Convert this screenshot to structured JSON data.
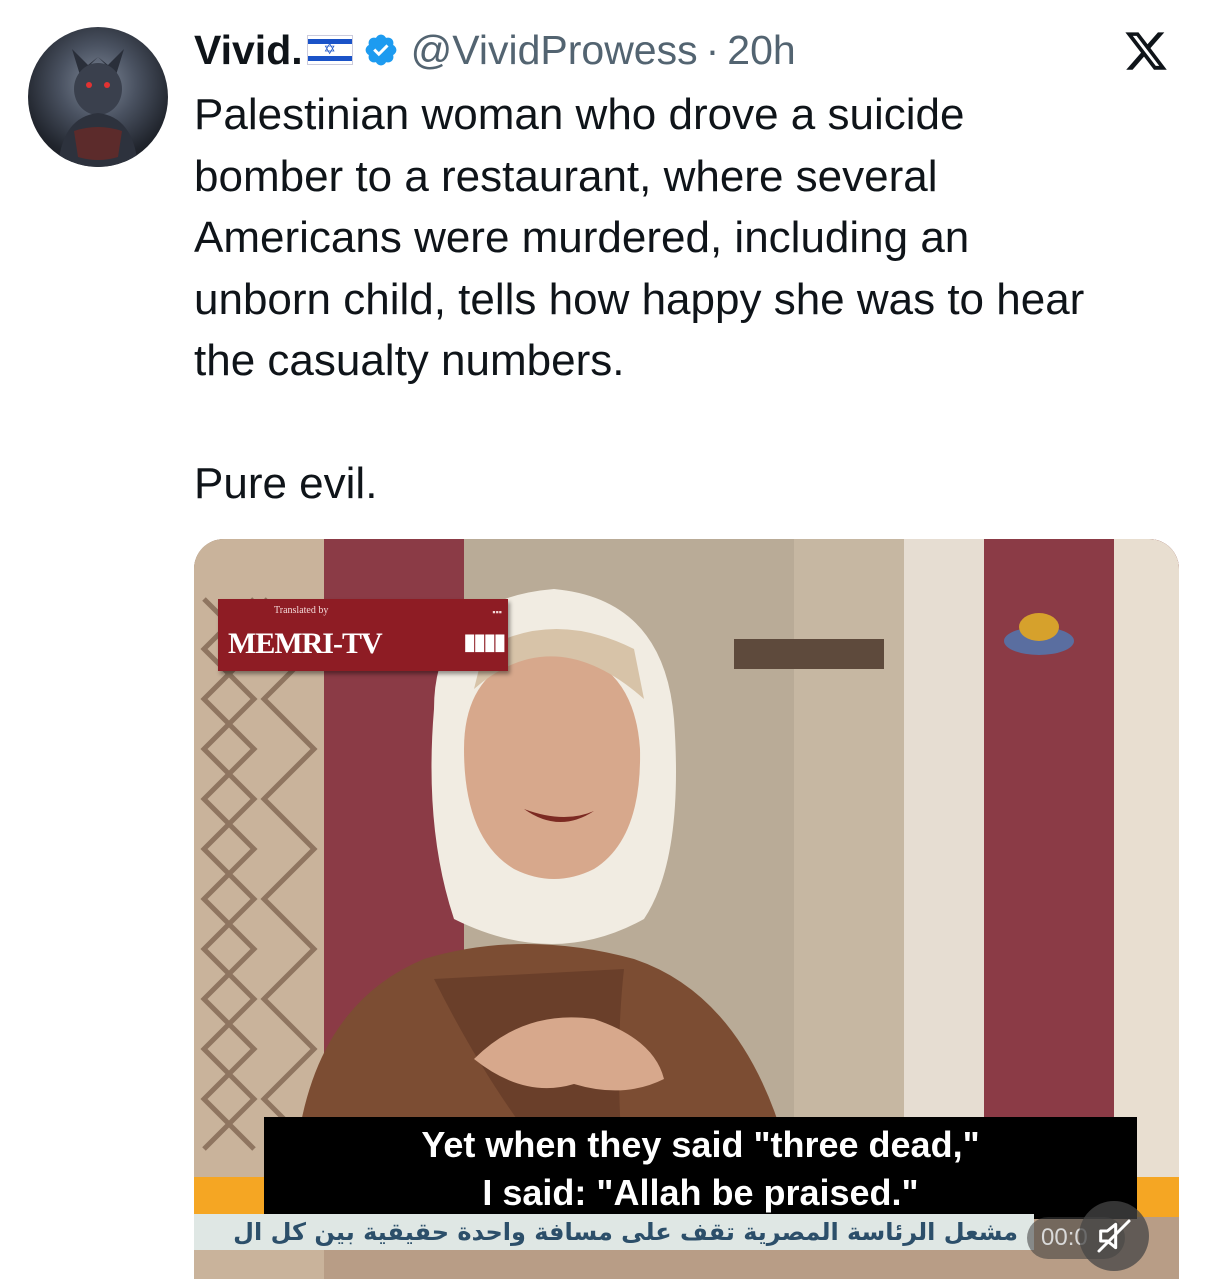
{
  "tweet": {
    "display_name": "Vivid.",
    "handle": "@VividProwess",
    "separator": "·",
    "time": "20h",
    "text": "Palestinian woman who drove a suicide\nbomber to a restaurant, where several\nAmericans were murdered, including an\nunborn child, tells how happy she was to hear\nthe casualty numbers.\n\nPure evil.",
    "flag_icon": "israel-flag-icon",
    "verified_icon": "verified-badge-icon",
    "platform_logo": "x-logo-icon"
  },
  "media": {
    "watermark_translated": "Translated by",
    "watermark_brand": "MEMRI-TV",
    "subtitle_line1": "Yet when they said \"three dead,\"",
    "subtitle_line2": "I said: \"Allah be praised.\"",
    "ticker_text": "مشعل الرئاسة المصرية تقف على مسافة واحدة حقيقية بين كل ال",
    "timer": "00:0",
    "mute_icon": "muted-speaker-icon"
  },
  "colors": {
    "verified_blue": "#1d9bf0",
    "secondary_text": "#536471",
    "memri_red": "#8e1c24"
  }
}
